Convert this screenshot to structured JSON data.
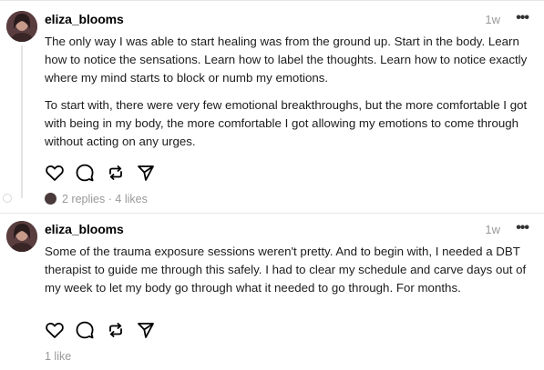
{
  "posts": [
    {
      "username": "eliza_blooms",
      "time": "1w",
      "more_icon": "more-horizontal-icon",
      "paragraphs": [
        "The only way I was able to start healing was from the ground up. Start in the body. Learn how to notice the sensations. Learn how to label the thoughts. Learn how to notice exactly where my mind starts to block or numb my emotions.",
        "To start with, there were very few emotional breakthroughs, but the more comfortable I got with being in my body, the more comfortable I got allowing my emotions to come through without acting on any urges."
      ],
      "replies": "2 replies",
      "likes": "4 likes",
      "separator": "·"
    },
    {
      "username": "eliza_blooms",
      "time": "1w",
      "more_icon": "more-horizontal-icon",
      "paragraphs": [
        "Some of the trauma exposure sessions weren't pretty. And to begin with, I needed a DBT therapist to guide me through this safely. I had to clear my schedule and carve days out of my week to let my body go through what it needed to go through. For months."
      ],
      "likes": "1 like"
    }
  ],
  "icons": {
    "like": "heart-icon",
    "reply": "comment-icon",
    "repost": "repost-icon",
    "share": "send-icon"
  },
  "colors": {
    "text": "#1c1c1c",
    "muted": "#999999",
    "divider": "#e6e6e6"
  }
}
